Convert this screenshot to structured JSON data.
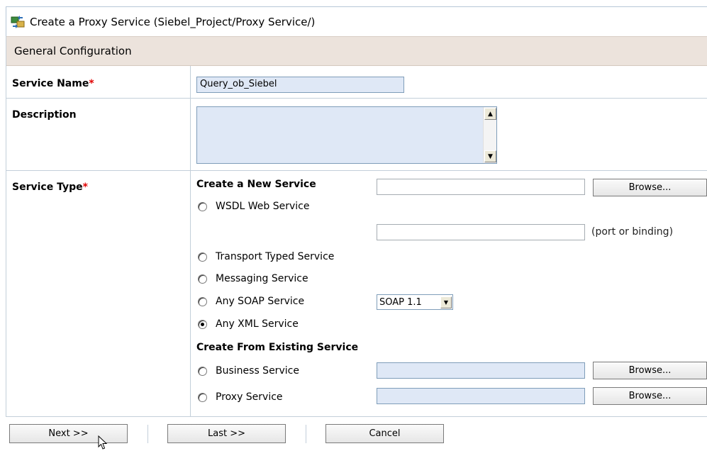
{
  "title": "Create a Proxy Service (Siebel_Project/Proxy Service/)",
  "section_title": "General Configuration",
  "required_mark": "*",
  "fields": {
    "service_name": {
      "label": "Service Name",
      "value": "Query_ob_Siebel"
    },
    "description": {
      "label": "Description",
      "value": ""
    },
    "service_type": {
      "label": "Service Type"
    }
  },
  "create_new": {
    "heading": "Create a New Service",
    "wsdl": {
      "label": "WSDL Web Service",
      "selected": false,
      "value": "",
      "browse_label": "Browse...",
      "port_value": "",
      "port_hint": "(port or binding)"
    },
    "transport_typed": {
      "label": "Transport Typed Service",
      "selected": false
    },
    "messaging": {
      "label": "Messaging Service",
      "selected": false
    },
    "any_soap": {
      "label": "Any SOAP Service",
      "selected": false,
      "soap_version": "SOAP 1.1"
    },
    "any_xml": {
      "label": "Any XML Service",
      "selected": true
    }
  },
  "create_existing": {
    "heading": "Create From Existing Service",
    "business": {
      "label": "Business Service",
      "selected": false,
      "value": "",
      "browse_label": "Browse..."
    },
    "proxy": {
      "label": "Proxy Service",
      "selected": false,
      "value": "",
      "browse_label": "Browse..."
    }
  },
  "buttons": {
    "next": "Next >>",
    "last": "Last >>",
    "cancel": "Cancel"
  },
  "icons": {
    "title_icon": "proxy-service-icon",
    "scroll_up": "scroll-up-arrow-icon",
    "scroll_down": "scroll-down-arrow-icon",
    "dropdown": "dropdown-arrow-icon",
    "cursor": "mouse-pointer-icon"
  },
  "colors": {
    "section_bg": "#ece3dc",
    "input_bg": "#dfe8f6",
    "required": "#e00000",
    "grid_line": "#c3cfda"
  }
}
